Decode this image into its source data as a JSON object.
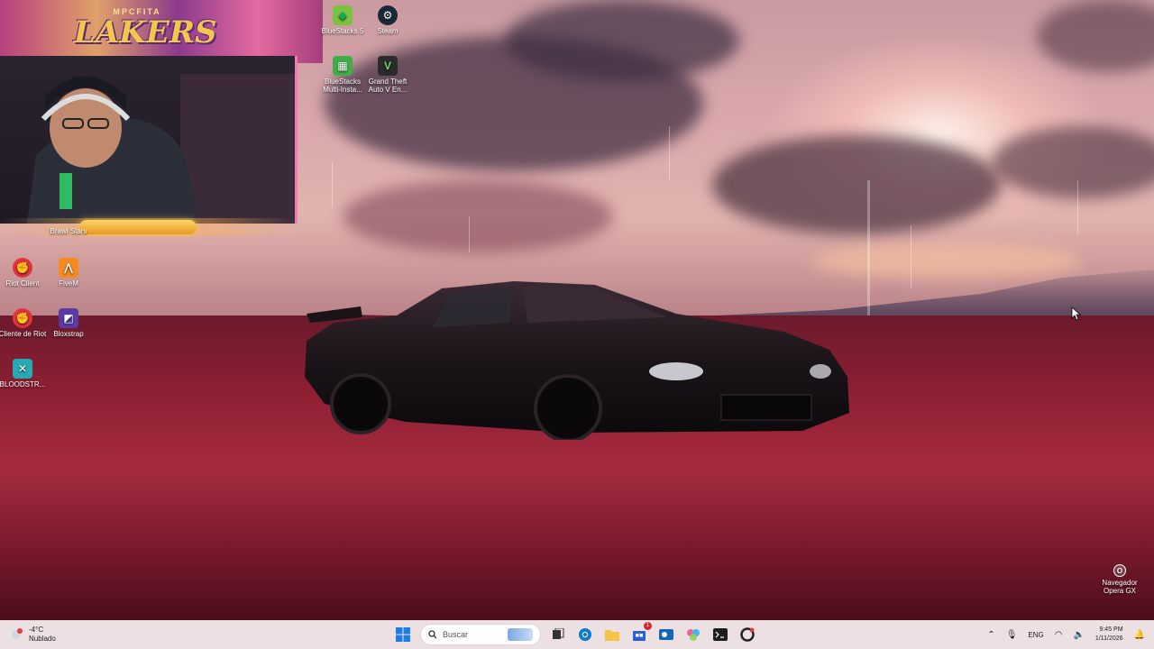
{
  "webcam": {
    "logo_top": "MPCFITA",
    "logo_main": "LAKERS"
  },
  "desktop_icons": [
    {
      "label": "BlueStacks 5",
      "icon": "bluestacks-icon"
    },
    {
      "label": "Steam",
      "icon": "steam-icon"
    },
    {
      "label": "BlueStacks Multi-Insta...",
      "icon": "bluestacks-multi-icon"
    },
    {
      "label": "Grand Theft Auto V En...",
      "icon": "gta-icon"
    },
    {
      "label": "Brawl Stars",
      "icon": "brawl-stars-icon"
    },
    {
      "label": "Riot Client",
      "icon": "riot-icon"
    },
    {
      "label": "FiveM",
      "icon": "fivem-icon"
    },
    {
      "label": "Cliente de Riot",
      "icon": "riot-icon"
    },
    {
      "label": "Bloxstrap",
      "icon": "bloxstrap-icon"
    },
    {
      "label": "BLOODSTR...",
      "icon": "bloodstrike-icon"
    },
    {
      "label": "Navegador Opera GX",
      "icon": "opera-gx-icon"
    }
  ],
  "taskbar": {
    "weather_temp": "-4°C",
    "weather_desc": "Nublado",
    "search_placeholder": "Buscar",
    "language": "ENG",
    "time": "9:45 PM",
    "date": "1/11/2026",
    "notification_count": "1"
  },
  "colors": {
    "taskbar_bg": "#faeef0",
    "accent_pink": "#f07ab2",
    "logo_gold": "#f3c64c"
  }
}
